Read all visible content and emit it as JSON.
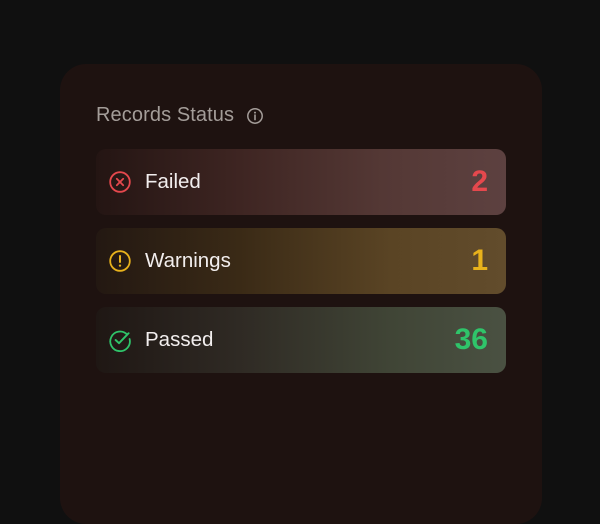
{
  "card": {
    "title": "Records Status",
    "info_icon": "info-icon"
  },
  "statuses": [
    {
      "label": "Failed",
      "count": "2",
      "icon": "x-circle-icon",
      "color": "#e5484d"
    },
    {
      "label": "Warnings",
      "count": "1",
      "icon": "exclamation-circle-icon",
      "color": "#e8b21c"
    },
    {
      "label": "Passed",
      "count": "36",
      "icon": "check-circle-icon",
      "color": "#2fc46a"
    }
  ]
}
